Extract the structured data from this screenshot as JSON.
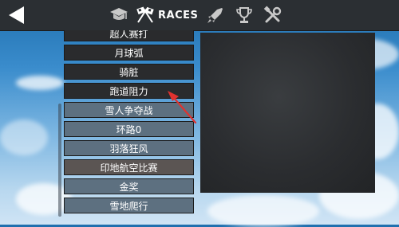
{
  "nav": {
    "races_label": "RACES",
    "icons": [
      "back-arrow-icon",
      "garage-hat-icon",
      "checkered-flags-icon",
      "rocket-icon",
      "trophy-icon",
      "tools-icon"
    ]
  },
  "race_list": {
    "items": [
      {
        "label": "超人赛打",
        "style": "dark"
      },
      {
        "label": "月球弧",
        "style": "dark"
      },
      {
        "label": "骑脏",
        "style": "dark"
      },
      {
        "label": "跑道阻力",
        "style": "dark"
      },
      {
        "label": "雪人争夺战",
        "style": "slate"
      },
      {
        "label": "环路0",
        "style": "slate"
      },
      {
        "label": "羽落狂风",
        "style": "slate"
      },
      {
        "label": "印地航空比赛",
        "style": "brown"
      },
      {
        "label": "金奖",
        "style": "slate"
      },
      {
        "label": "雪地爬行",
        "style": "slate"
      }
    ]
  },
  "colors": {
    "annotation_arrow": "#e0322f",
    "topbar": "#2b2f33"
  }
}
